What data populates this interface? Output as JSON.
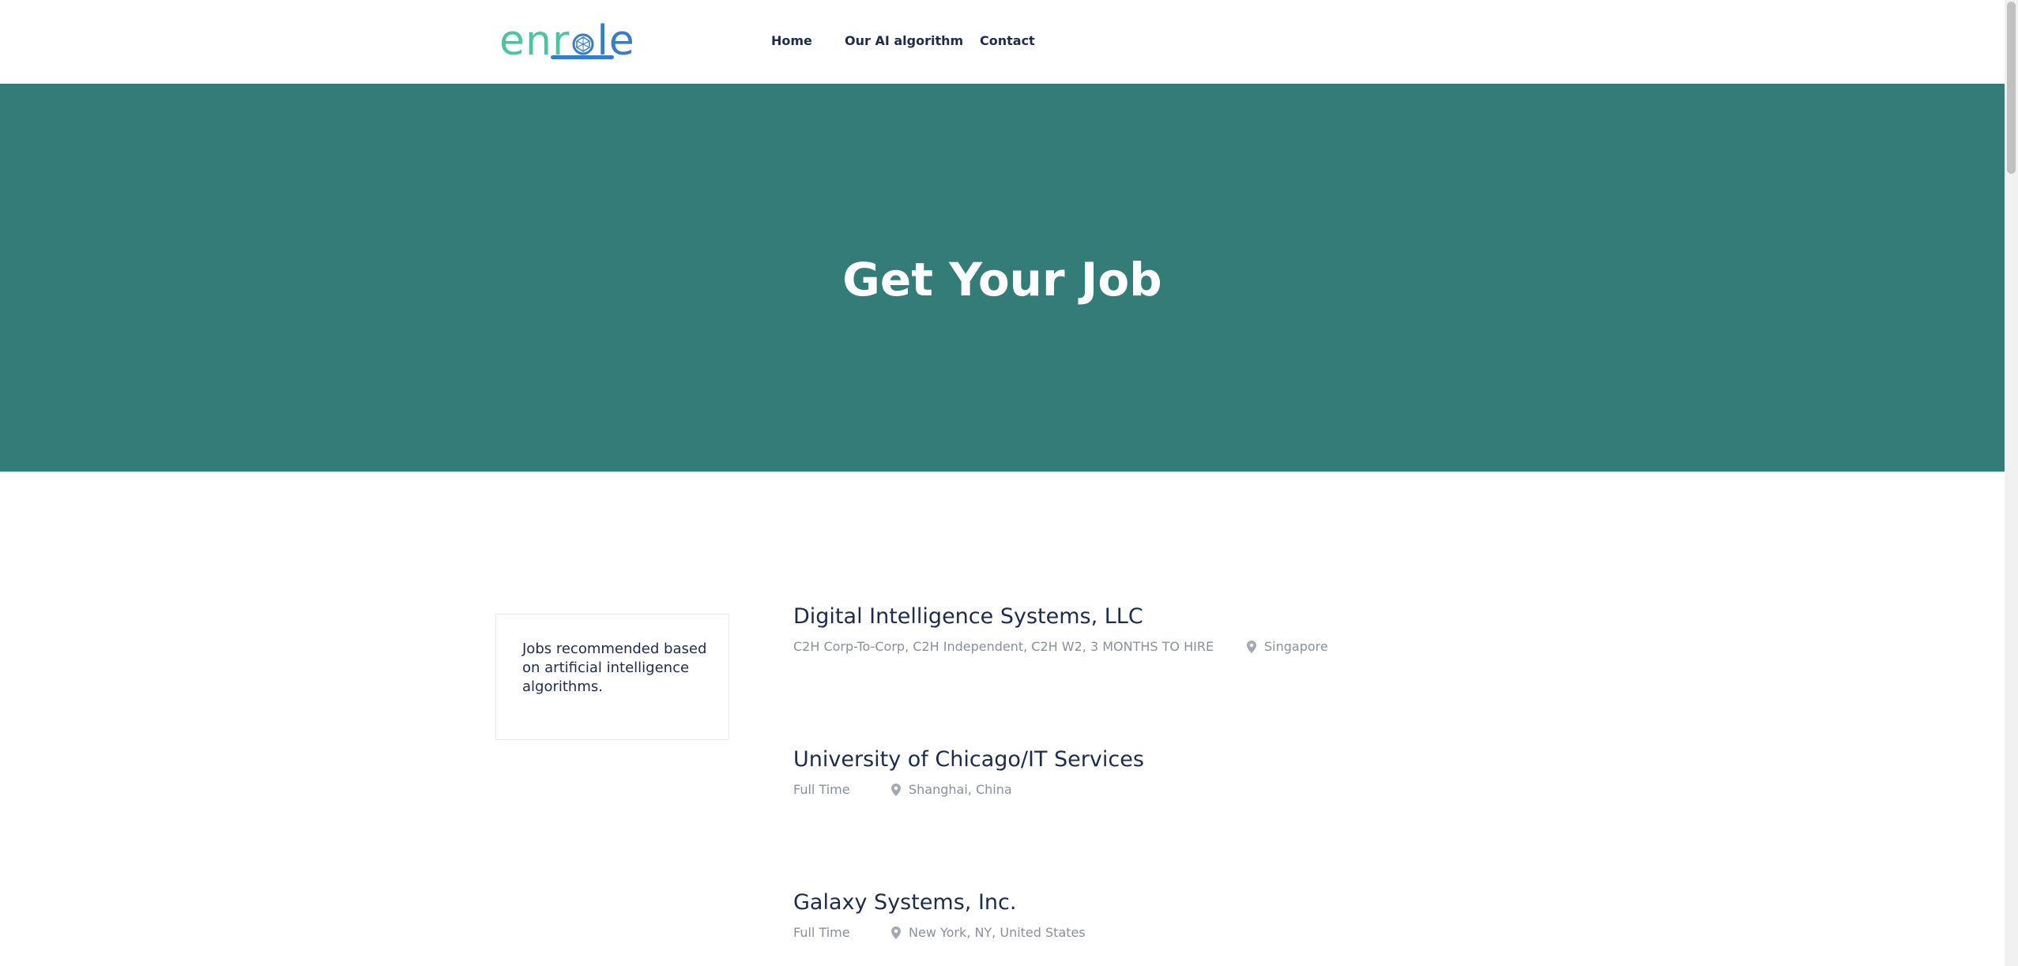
{
  "header": {
    "logo": {
      "part_a": "enr",
      "part_b": "le",
      "brand_green": "#4fc3a1",
      "brand_blue": "#3a7cc4"
    },
    "nav": [
      {
        "label": "Home"
      },
      {
        "label": "Our AI algorithm"
      },
      {
        "label": "Contact"
      }
    ]
  },
  "hero": {
    "title": "Get Your Job",
    "background": "#337c78"
  },
  "sidebar": {
    "text": "Jobs recommended based on artificial intelligence algorithms."
  },
  "jobs": [
    {
      "company": "Digital Intelligence Systems, LLC",
      "type": "C2H Corp-To-Corp, C2H Independent, C2H W2, 3 MONTHS TO HIRE",
      "location": "Singapore",
      "icon": "map-pin-icon"
    },
    {
      "company": "University of Chicago/IT Services",
      "type": "Full Time",
      "location": "Shanghai, China",
      "icon": "map-pin-icon"
    },
    {
      "company": "Galaxy Systems, Inc.",
      "type": "Full Time",
      "location": "New York, NY, United States",
      "icon": "map-pin-icon"
    }
  ]
}
